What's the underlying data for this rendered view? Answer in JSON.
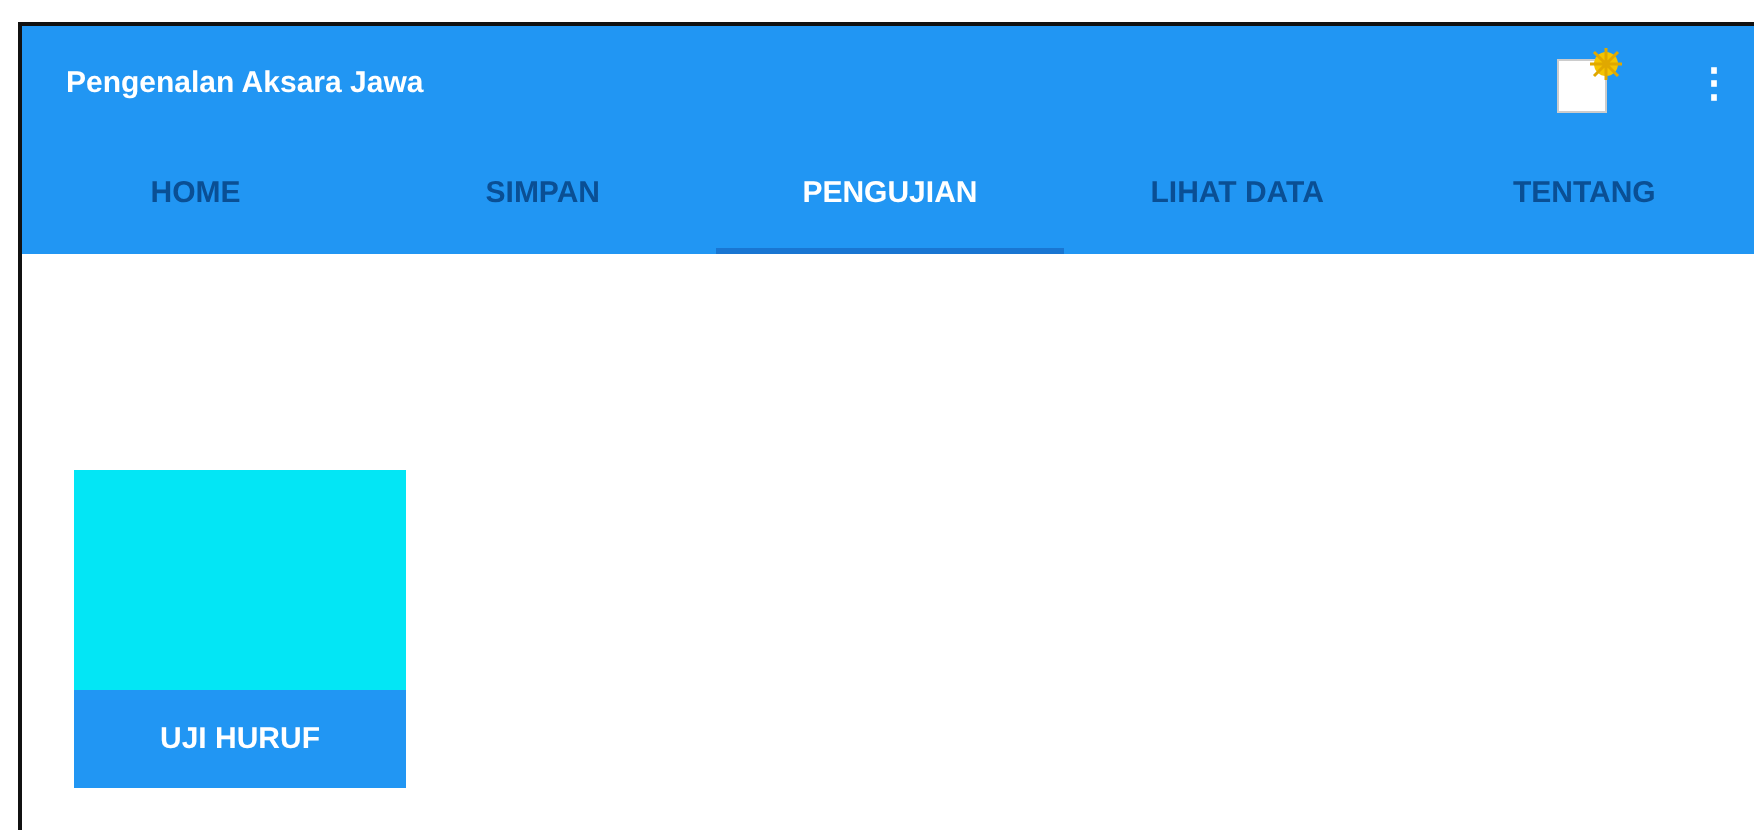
{
  "app_bar": {
    "title": "Pengenalan Aksara Jawa",
    "menu_icon": "⋮"
  },
  "tabs": [
    {
      "label": "HOME",
      "selected": false
    },
    {
      "label": "SIMPAN",
      "selected": false
    },
    {
      "label": "PENGUJIAN",
      "selected": true
    },
    {
      "label": "LIHAT DATA",
      "selected": false
    },
    {
      "label": "TENTANG",
      "selected": false
    }
  ],
  "cards": [
    {
      "label": "UJI HURUF",
      "color": "#03e6f5"
    }
  ]
}
